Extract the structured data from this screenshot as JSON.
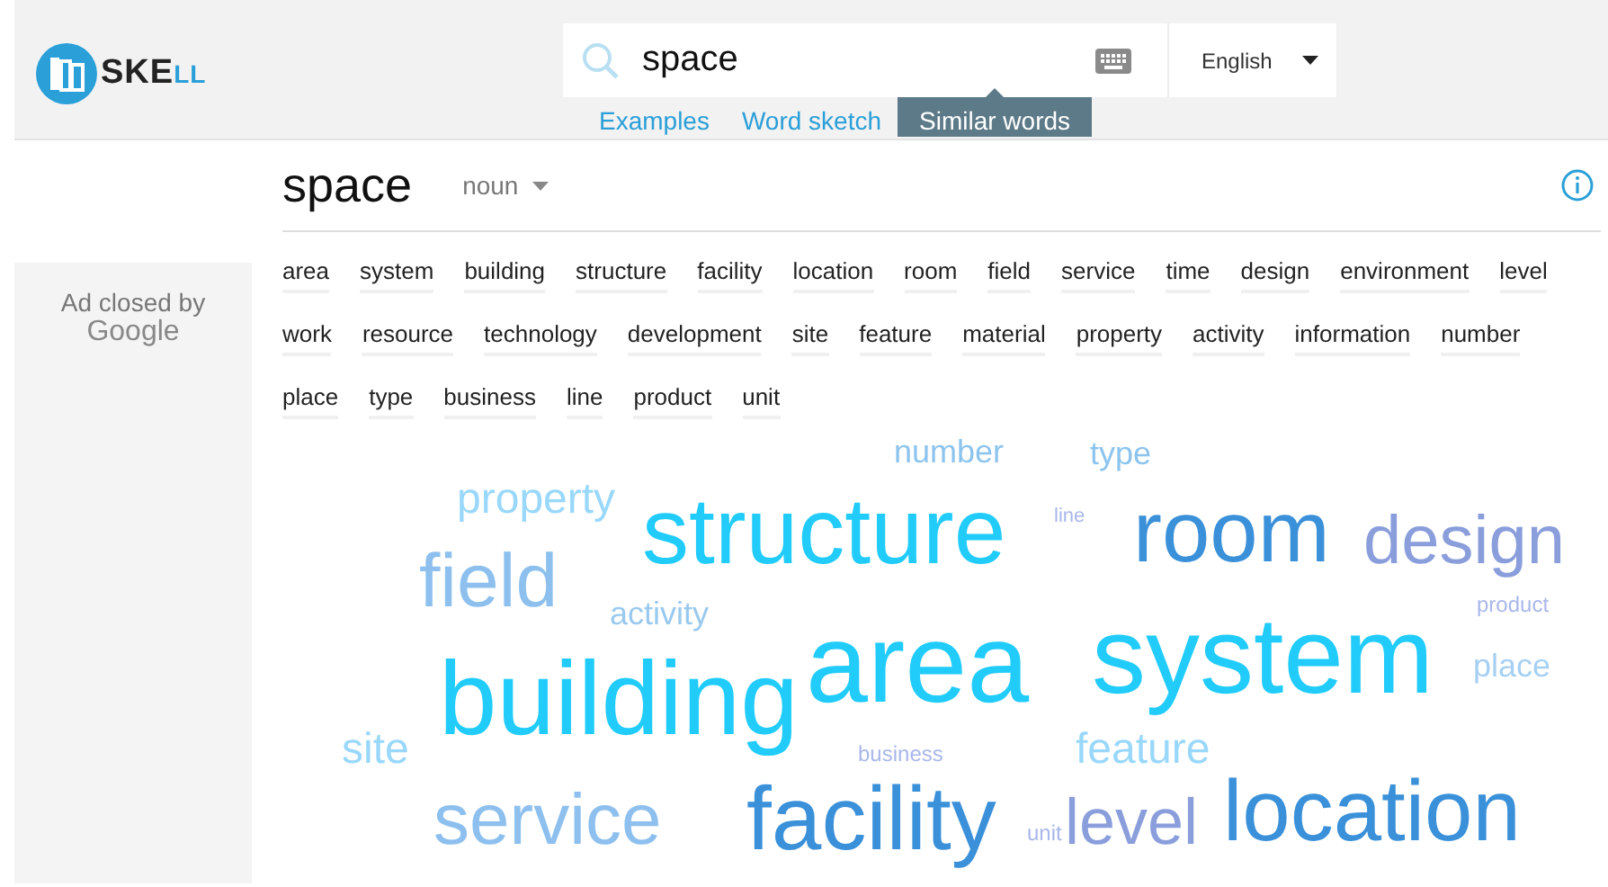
{
  "logo": {
    "text": "SKE",
    "suffix": "LL"
  },
  "search": {
    "value": "space"
  },
  "language": {
    "value": "English"
  },
  "tabs": [
    {
      "label": "Examples",
      "selected": false
    },
    {
      "label": "Word sketch",
      "selected": false
    },
    {
      "label": "Similar words",
      "selected": true
    }
  ],
  "ad": {
    "line_1": "Ad closed by",
    "line_2": "Google"
  },
  "headword": {
    "word": "space",
    "pos": "noun"
  },
  "similar_words": [
    "area",
    "system",
    "building",
    "structure",
    "facility",
    "location",
    "room",
    "field",
    "service",
    "time",
    "design",
    "environment",
    "level",
    "work",
    "resource",
    "technology",
    "development",
    "site",
    "feature",
    "material",
    "property",
    "activity",
    "information",
    "number",
    "place",
    "type",
    "business",
    "line",
    "product",
    "unit"
  ],
  "word_cloud": [
    {
      "word": "number",
      "color": "#8cc4ee"
    },
    {
      "word": "type",
      "color": "#8cc4ee"
    },
    {
      "word": "property",
      "color": "#99d8fb"
    },
    {
      "word": "structure",
      "color": "#22ccfa"
    },
    {
      "word": "line",
      "color": "#a9b7ea"
    },
    {
      "word": "room",
      "color": "#3a90d9"
    },
    {
      "word": "design",
      "color": "#8a9edb"
    },
    {
      "word": "field",
      "color": "#8dc0ee"
    },
    {
      "word": "activity",
      "color": "#99c9ee"
    },
    {
      "word": "product",
      "color": "#a9b7ea"
    },
    {
      "word": "building",
      "color": "#22ccfa"
    },
    {
      "word": "area",
      "color": "#22ccfa"
    },
    {
      "word": "system",
      "color": "#22ccfa"
    },
    {
      "word": "place",
      "color": "#a6d0f3"
    },
    {
      "word": "site",
      "color": "#99d8fb"
    },
    {
      "word": "business",
      "color": "#a9b7ea"
    },
    {
      "word": "feature",
      "color": "#99d8fb"
    },
    {
      "word": "service",
      "color": "#8dc0ee"
    },
    {
      "word": "facility",
      "color": "#3a90d9"
    },
    {
      "word": "unit",
      "color": "#a9b7ea"
    },
    {
      "word": "level",
      "color": "#8a9edb"
    },
    {
      "word": "location",
      "color": "#3a90d9"
    }
  ]
}
